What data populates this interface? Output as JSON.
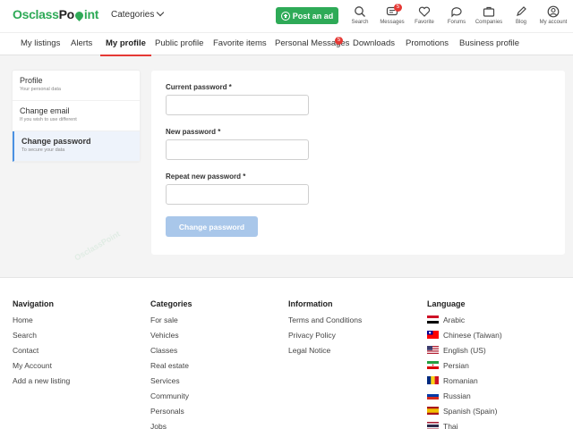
{
  "header": {
    "logo_text_1": "Osclass",
    "logo_text_2": "int",
    "categories_label": "Categories",
    "post_ad_label": "Post an ad",
    "icons": [
      {
        "name": "search-icon",
        "label": "Search",
        "badge": ""
      },
      {
        "name": "messages-icon",
        "label": "Messages",
        "badge": "5"
      },
      {
        "name": "favorite-icon",
        "label": "Favorite",
        "badge": ""
      },
      {
        "name": "forums-icon",
        "label": "Forums",
        "badge": ""
      },
      {
        "name": "companies-icon",
        "label": "Companies",
        "badge": ""
      },
      {
        "name": "blog-icon",
        "label": "Blog",
        "badge": ""
      },
      {
        "name": "account-icon",
        "label": "My account",
        "badge": ""
      }
    ],
    "brand_color": "#2eaa57"
  },
  "tabs": {
    "items": [
      {
        "label": "My listings"
      },
      {
        "label": "Alerts"
      },
      {
        "label": "My profile"
      },
      {
        "label": "Public profile"
      },
      {
        "label": "Favorite items"
      },
      {
        "label": "Personal Messages",
        "badge": "5"
      },
      {
        "label": "Downloads"
      },
      {
        "label": "Promotions"
      },
      {
        "label": "Business profile"
      }
    ],
    "active": "My profile"
  },
  "sidebar": {
    "items": [
      {
        "title": "Profile",
        "subtitle": "Your personal data"
      },
      {
        "title": "Change email",
        "subtitle": "If you wish to use different"
      },
      {
        "title": "Change password",
        "subtitle": "To secure your data"
      }
    ],
    "active": "Change password"
  },
  "form": {
    "current_label": "Current password *",
    "current_value": "",
    "new_label": "New password *",
    "new_value": "",
    "repeat_label": "Repeat new password *",
    "repeat_value": "",
    "submit_label": "Change password"
  },
  "footer": {
    "navigation": {
      "title": "Navigation",
      "links": [
        "Home",
        "Search",
        "Contact",
        "My Account",
        "Add a new listing"
      ]
    },
    "categories": {
      "title": "Categories",
      "links": [
        "For sale",
        "Vehicles",
        "Classes",
        "Real estate",
        "Services",
        "Community",
        "Personals",
        "Jobs"
      ]
    },
    "information": {
      "title": "Information",
      "links": [
        "Terms and Conditions",
        "Privacy Policy",
        "Legal Notice"
      ]
    },
    "language": {
      "title": "Language",
      "items": [
        {
          "label": "Arabic",
          "flag": "arabic-flag-icon"
        },
        {
          "label": "Chinese (Taiwan)",
          "flag": "taiwan-flag-icon"
        },
        {
          "label": "English (US)",
          "flag": "us-flag-icon"
        },
        {
          "label": "Persian",
          "flag": "iran-flag-icon"
        },
        {
          "label": "Romanian",
          "flag": "romania-flag-icon"
        },
        {
          "label": "Russian",
          "flag": "russia-flag-icon"
        },
        {
          "label": "Spanish (Spain)",
          "flag": "spain-flag-icon"
        },
        {
          "label": "Thai",
          "flag": "thailand-flag-icon"
        }
      ]
    }
  },
  "watermark_text": "OsclassPoint"
}
